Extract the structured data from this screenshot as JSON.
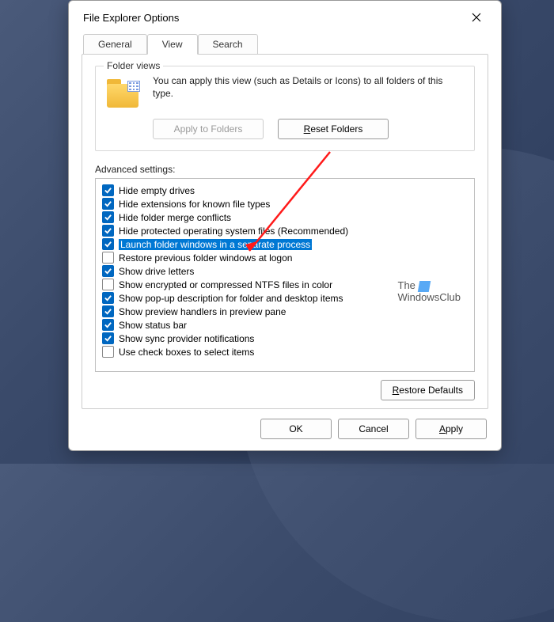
{
  "dialog": {
    "title": "File Explorer Options",
    "tabs": [
      "General",
      "View",
      "Search"
    ],
    "active_tab": 1
  },
  "folder_views": {
    "legend": "Folder views",
    "description": "You can apply this view (such as Details or Icons) to all folders of this type.",
    "apply_btn": "Apply to Folders",
    "reset_btn": "Reset Folders"
  },
  "advanced": {
    "label": "Advanced settings:",
    "settings": [
      {
        "checked": true,
        "label": "Hide empty drives",
        "highlight": false
      },
      {
        "checked": true,
        "label": "Hide extensions for known file types",
        "highlight": false
      },
      {
        "checked": true,
        "label": "Hide folder merge conflicts",
        "highlight": false
      },
      {
        "checked": true,
        "label": "Hide protected operating system files (Recommended)",
        "highlight": false
      },
      {
        "checked": true,
        "label": "Launch folder windows in a separate process",
        "highlight": true
      },
      {
        "checked": false,
        "label": "Restore previous folder windows at logon",
        "highlight": false
      },
      {
        "checked": true,
        "label": "Show drive letters",
        "highlight": false
      },
      {
        "checked": false,
        "label": "Show encrypted or compressed NTFS files in color",
        "highlight": false
      },
      {
        "checked": true,
        "label": "Show pop-up description for folder and desktop items",
        "highlight": false
      },
      {
        "checked": true,
        "label": "Show preview handlers in preview pane",
        "highlight": false
      },
      {
        "checked": true,
        "label": "Show status bar",
        "highlight": false
      },
      {
        "checked": true,
        "label": "Show sync provider notifications",
        "highlight": false
      },
      {
        "checked": false,
        "label": "Use check boxes to select items",
        "highlight": false
      }
    ],
    "restore_defaults": "Restore Defaults"
  },
  "buttons": {
    "ok": "OK",
    "cancel": "Cancel",
    "apply": "Apply"
  },
  "watermark": {
    "line1": "The",
    "line2": "WindowsClub"
  }
}
